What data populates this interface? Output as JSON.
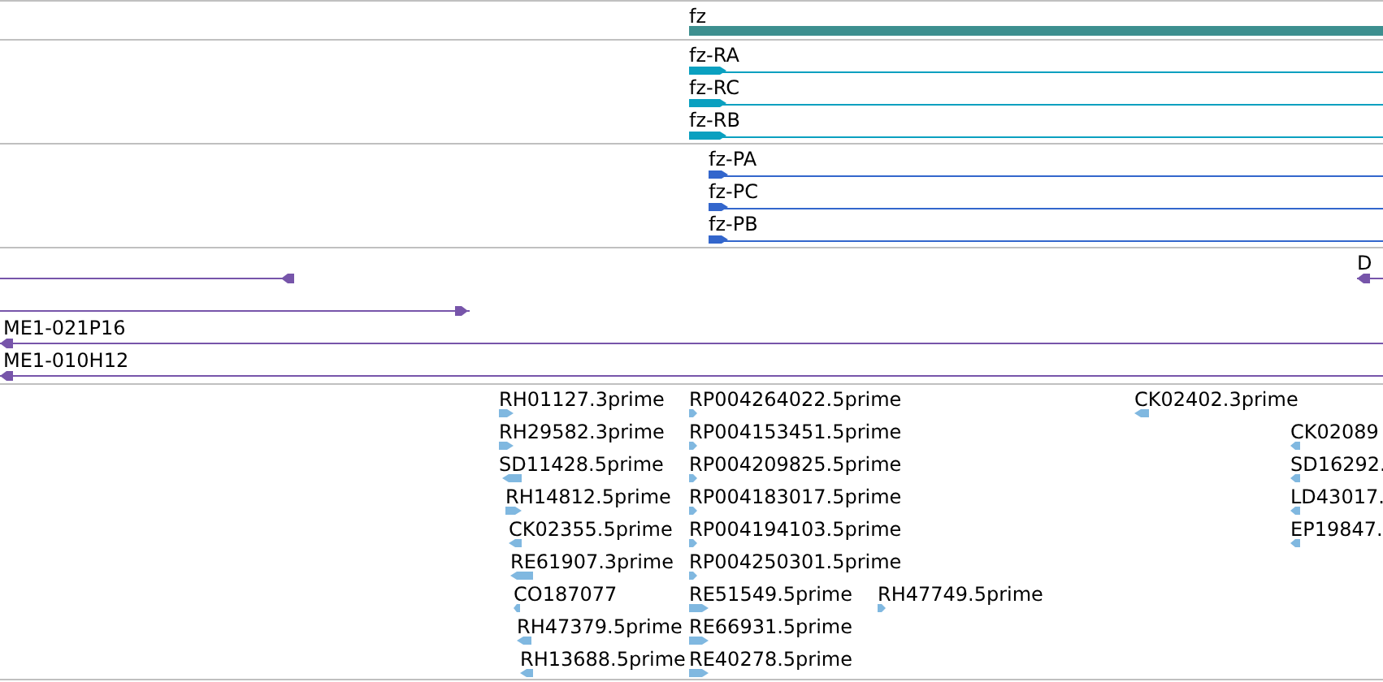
{
  "tracks": [
    {
      "kind": "gene",
      "color": "#3d8f8f",
      "rows": [
        [
          {
            "label": "fz"
          }
        ]
      ]
    },
    {
      "kind": "transcript",
      "color": "#0aa0c0",
      "rows": [
        [
          {
            "label": "fz-RA",
            "reverse": false
          }
        ],
        [
          {
            "label": "fz-RC",
            "reverse": false
          }
        ],
        [
          {
            "label": "fz-RB",
            "reverse": false
          }
        ]
      ]
    },
    {
      "kind": "protein",
      "color": "#3366cc",
      "rows": [
        [
          {
            "label": "fz-PA",
            "reverse": false
          }
        ],
        [
          {
            "label": "fz-PC",
            "reverse": false
          }
        ],
        [
          {
            "label": "fz-PB",
            "reverse": false
          }
        ]
      ]
    },
    {
      "kind": "clone",
      "color": "#7755aa",
      "rows": [
        [
          {
            "reverse": true
          },
          {
            "label": "D",
            "reverse": true
          }
        ],
        [
          {
            "reverse": false
          }
        ],
        [
          {
            "label": "ME1-021P16",
            "reverse": true
          }
        ],
        [
          {
            "label": "ME1-010H12",
            "reverse": true
          }
        ]
      ]
    },
    {
      "kind": "est",
      "color": "#80b8e0",
      "rows": [
        [
          {
            "label": "RH01127.3prime",
            "reverse": false
          },
          {
            "label": "RP004264022.5prime",
            "reverse": false
          },
          {
            "label": "CK02402.3prime",
            "reverse": true
          }
        ],
        [
          {
            "label": "RH29582.3prime",
            "reverse": false
          },
          {
            "label": "RP004153451.5prime",
            "reverse": false
          },
          {
            "label": "CK02089",
            "reverse": true
          }
        ],
        [
          {
            "label": "SD11428.5prime",
            "reverse": true
          },
          {
            "label": "RP004209825.5prime",
            "reverse": false
          },
          {
            "label": "SD16292.",
            "reverse": true
          }
        ],
        [
          {
            "label": "RH14812.5prime",
            "reverse": false
          },
          {
            "label": "RP004183017.5prime",
            "reverse": false
          },
          {
            "label": "LD43017.",
            "reverse": true
          }
        ],
        [
          {
            "label": "CK02355.5prime",
            "reverse": true
          },
          {
            "label": "RP004194103.5prime",
            "reverse": false
          },
          {
            "label": "EP19847.",
            "reverse": true
          }
        ],
        [
          {
            "label": "RE61907.3prime",
            "reverse": true
          },
          {
            "label": "RP004250301.5prime",
            "reverse": false
          }
        ],
        [
          {
            "label": "CO187077",
            "reverse": true
          },
          {
            "label": "RE51549.5prime",
            "reverse": false
          },
          {
            "label": "RH47749.5prime",
            "reverse": false
          }
        ],
        [
          {
            "label": "RH47379.5prime",
            "reverse": true
          },
          {
            "label": "RE66931.5prime",
            "reverse": false
          }
        ],
        [
          {
            "label": "RH13688.5prime",
            "reverse": true
          },
          {
            "label": "RE40278.5prime",
            "reverse": false
          }
        ]
      ]
    }
  ]
}
